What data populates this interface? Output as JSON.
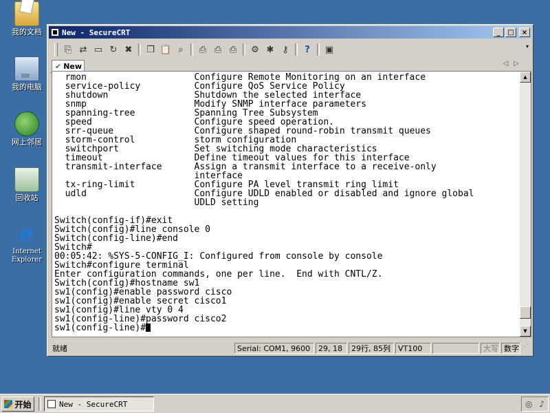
{
  "desktop": {
    "icons": [
      {
        "label": "我的文档",
        "icon": "my-documents-icon"
      },
      {
        "label": "我的电脑",
        "icon": "my-computer-icon"
      },
      {
        "label": "网上邻居",
        "icon": "network-icon"
      },
      {
        "label": "回收站",
        "icon": "recycle-bin-icon"
      },
      {
        "label": "Internet\nExplorer",
        "icon": "internet-explorer-icon"
      }
    ]
  },
  "window": {
    "title": "New - SecureCRT",
    "controls": {
      "minimize": "_",
      "maximize": "□",
      "close": "×"
    },
    "toolbar": {
      "buttons": [
        "connect-icon",
        "quick-connect-icon",
        "connect-tab-icon",
        "reconnect-icon",
        "disconnect-icon",
        "copy-icon",
        "paste-icon",
        "find-icon",
        "print-icon",
        "print-selection-icon",
        "print-setup-icon",
        "session-options-icon",
        "global-options-icon",
        "keymap-icon",
        "help-icon",
        "screen-capture-icon"
      ],
      "glyphs": [
        "⎘",
        "⇄",
        "▭",
        "↻",
        "✖",
        "❐",
        "📋",
        "⌕",
        "⎙",
        "⎙",
        "⎙",
        "⚙",
        "✱",
        "⚷",
        "?",
        "▣"
      ],
      "overflow": "▾"
    },
    "tab": {
      "check": "✔",
      "label": "New",
      "nav_prev": "◁",
      "nav_next": "▷"
    },
    "terminal": {
      "lines": [
        "  rmon                    Configure Remote Monitoring on an interface",
        "  service-policy          Configure QoS Service Policy",
        "  shutdown                Shutdown the selected interface",
        "  snmp                    Modify SNMP interface parameters",
        "  spanning-tree           Spanning Tree Subsystem",
        "  speed                   Configure speed operation.",
        "  srr-queue               Configure shaped round-robin transmit queues",
        "  storm-control           storm configuration",
        "  switchport              Set switching mode characteristics",
        "  timeout                 Define timeout values for this interface",
        "  transmit-interface      Assign a transmit interface to a receive-only",
        "                          interface",
        "  tx-ring-limit           Configure PA level transmit ring limit",
        "  udld                    Configure UDLD enabled or disabled and ignore global",
        "                          UDLD setting",
        "",
        "Switch(config-if)#exit",
        "Switch(config)#line console 0",
        "Switch(config-line)#end",
        "Switch#",
        "00:05:42: %SYS-5-CONFIG_I: Configured from console by console",
        "Switch#configure terminal",
        "Enter configuration commands, one per line.  End with CNTL/Z.",
        "Switch(config)#hostname sw1",
        "sw1(config)#enable password cisco",
        "sw1(config)#enable secret cisco1",
        "sw1(config)#line vty 0 4",
        "sw1(config-line)#password cisco2"
      ],
      "prompt": "sw1(config-line)#",
      "scroll_position": 0.97
    },
    "statusbar": {
      "ready": "就绪",
      "serial": "Serial: COM1, 9600",
      "cursor": "29, 18",
      "size": "29行, 85列",
      "emulation": "VT100",
      "caps": "大写",
      "num": "数字"
    }
  },
  "taskbar": {
    "start_label": "开始",
    "task_title": "New - SecureCRT",
    "tray_icons": [
      "network-tray-icon",
      "volume-tray-icon"
    ]
  }
}
